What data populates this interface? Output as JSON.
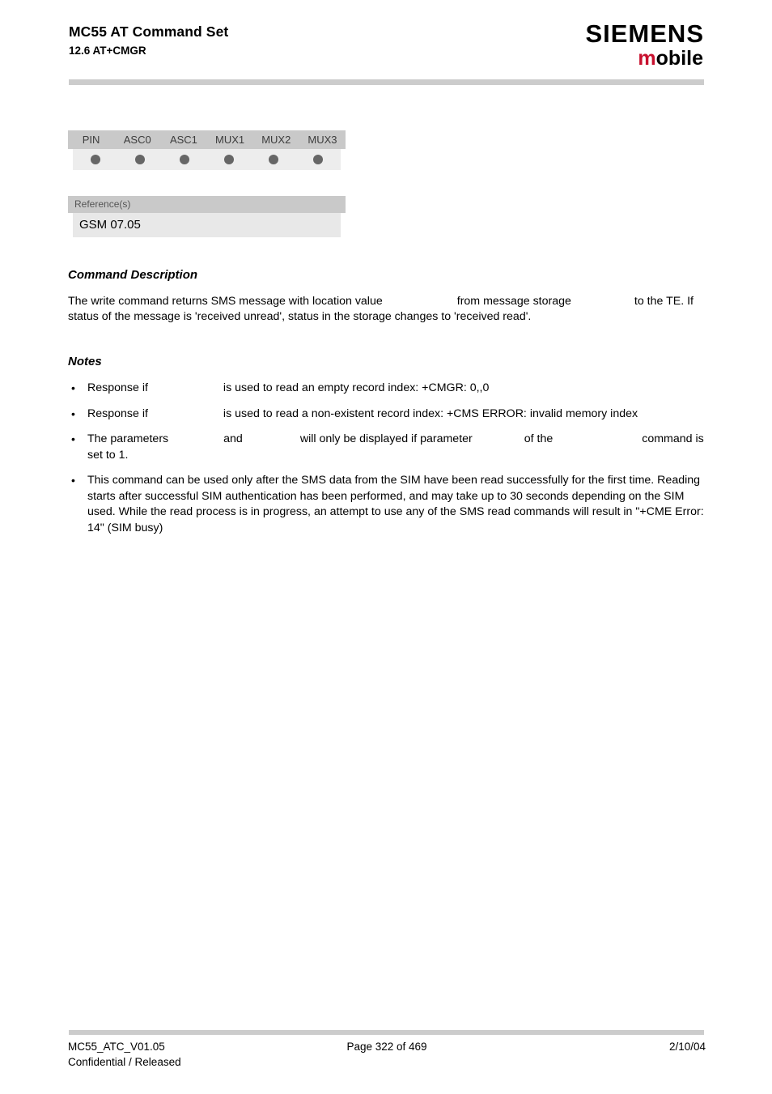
{
  "header": {
    "doc_title": "MC55 AT Command Set",
    "section_number_title": "12.6 AT+CMGR",
    "logo_siemens": "SIEMENS",
    "logo_mobile_m": "m",
    "logo_mobile_rest": "obile"
  },
  "status_table": {
    "columns": [
      "PIN",
      "ASC0",
      "ASC1",
      "MUX1",
      "MUX2",
      "MUX3"
    ],
    "marks": [
      "dot",
      "dot",
      "dot",
      "dot",
      "dot",
      "dot"
    ]
  },
  "reference_box": {
    "label": "Reference(s)",
    "value": "GSM 07.05"
  },
  "command_description": {
    "heading": "Command Description",
    "paragraph_part1": "The write command returns SMS message with location value",
    "paragraph_part2": "from message storage",
    "paragraph_part3": "to the TE. If status of the message is 'received unread', status in the storage changes to 'received read'."
  },
  "notes": {
    "heading": "Notes",
    "items": [
      {
        "bullet": "•",
        "part1": "Response if",
        "part2": "is used to read an empty record index: +CMGR: 0,,0"
      },
      {
        "bullet": "•",
        "part1": "Response if",
        "part2": "is used to read a non-existent record index: +CMS ERROR: invalid memory index"
      },
      {
        "bullet": "•",
        "part1": "The parameters",
        "part2": "and",
        "part3": "will only be displayed if parameter",
        "part4": "of the",
        "part5": "command is set to 1."
      },
      {
        "bullet": "•",
        "part1": "This command can be used only after the SMS data from the SIM have been read successfully for the first time. Reading starts after successful SIM authentication has been performed, and may take up to 30 seconds depending on the SIM used. While the read process is in progress, an attempt to use any of the SMS read commands will result in \"+CME Error: 14\" (SIM busy)"
      }
    ]
  },
  "footer": {
    "doc_id": "MC55_ATC_V01.05",
    "page": "Page 322 of 469",
    "date": "2/10/04",
    "classification": "Confidential / Released"
  }
}
